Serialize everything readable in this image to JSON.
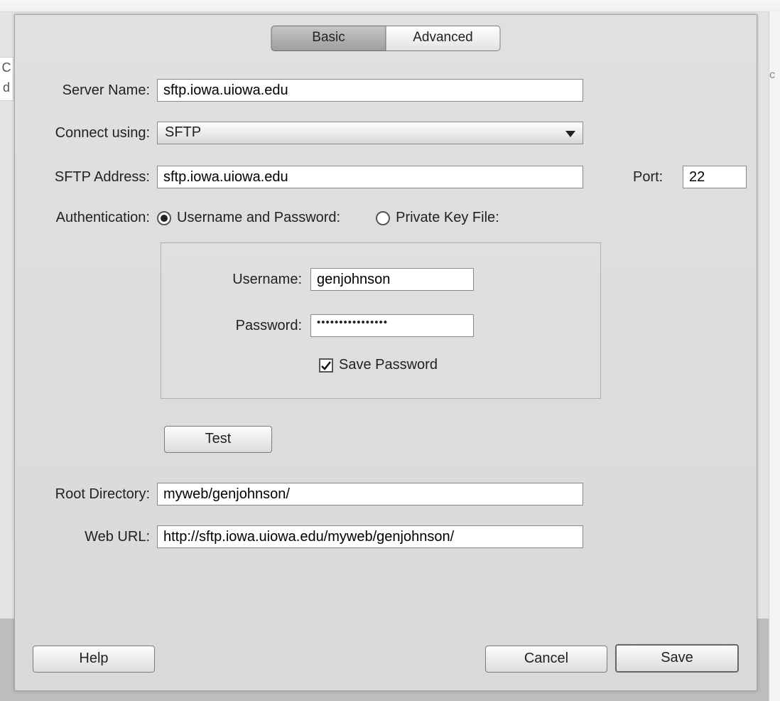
{
  "tabs": {
    "basic": "Basic",
    "advanced": "Advanced"
  },
  "labels": {
    "server_name": "Server Name:",
    "connect_using": "Connect using:",
    "sftp_address": "SFTP Address:",
    "port": "Port:",
    "authentication": "Authentication:",
    "root_directory": "Root Directory:",
    "web_url": "Web URL:",
    "username": "Username:",
    "password": "Password:",
    "save_password": "Save Password"
  },
  "radio": {
    "user_pass": "Username and Password:",
    "private_key": "Private Key File:",
    "selected": "user_pass"
  },
  "values": {
    "server_name": "sftp.iowa.uiowa.edu",
    "connect_using": "SFTP",
    "sftp_address": "sftp.iowa.uiowa.edu",
    "port": "22",
    "username": "genjohnson",
    "password_mask": "••••••••••••••••",
    "save_password_checked": true,
    "root_directory": "myweb/genjohnson/",
    "web_url": "http://sftp.iowa.uiowa.edu/myweb/genjohnson/"
  },
  "buttons": {
    "test": "Test",
    "help": "Help",
    "cancel": "Cancel",
    "save": "Save"
  }
}
